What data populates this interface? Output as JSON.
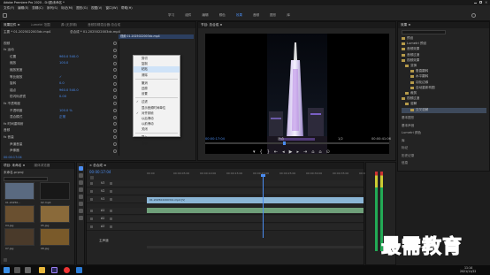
{
  "window": {
    "title": "Adobe Premiere Pro 2020 - D:\\图\\未命名 *"
  },
  "menu": [
    "文件(F)",
    "编辑(E)",
    "剪辑(C)",
    "序列(S)",
    "标记(M)",
    "图形(G)",
    "视图(V)",
    "窗口(W)",
    "帮助(H)"
  ],
  "workspaces": [
    "学习",
    "组件",
    "编辑",
    "颜色",
    "效果",
    "音频",
    "图形",
    "库"
  ],
  "effect_controls": {
    "tabs": [
      "效果控件 ≡",
      "Lumetri 范围",
      "源:(无剪辑)",
      "音频剪辑混合器:总合成"
    ],
    "source_label": "主要 * 01.2025022003dc.mp4",
    "seq_label": "总合成 * 01.2025022003dc.mp4",
    "rows": [
      {
        "name": "视频",
        "value": ""
      },
      {
        "name": "fx 运动",
        "value": ""
      },
      {
        "name": "位置",
        "value": "960.0   540.0"
      },
      {
        "name": "缩放",
        "value": "100.0"
      },
      {
        "name": "缩放宽度",
        "value": ""
      },
      {
        "name": "等比缩放",
        "value": "✓"
      },
      {
        "name": "旋转",
        "value": "0.0"
      },
      {
        "name": "锚点",
        "value": "960.0   540.0"
      },
      {
        "name": "防闪烁滤镜",
        "value": "0.00"
      },
      {
        "name": "fx 不透明度",
        "value": ""
      },
      {
        "name": "不透明度",
        "value": "100.0 %"
      },
      {
        "name": "混合模式",
        "value": "正常"
      },
      {
        "name": "fx 时间重映射",
        "value": ""
      },
      {
        "name": "音频",
        "value": ""
      },
      {
        "name": "fx 音量",
        "value": ""
      },
      {
        "name": "声道音量",
        "value": ""
      },
      {
        "name": "声像器",
        "value": ""
      }
    ],
    "clip_tooltip": "视频 01.2025022003dc.mp4",
    "timecode": "00:00:17:04"
  },
  "context_menu": {
    "items": [
      {
        "label": "剪切",
        "sep": false,
        "check": false,
        "hl": false
      },
      {
        "label": "复制",
        "sep": false,
        "check": false,
        "hl": false
      },
      {
        "label": "粘贴",
        "sep": false,
        "check": false,
        "hl": true
      },
      {
        "label": "清除",
        "sep": false,
        "check": false,
        "hl": false
      },
      {
        "label": "撤消",
        "sep": true,
        "check": false,
        "hl": false
      },
      {
        "label": "还原",
        "sep": false,
        "check": false,
        "hl": false
      },
      {
        "label": "设置",
        "sep": false,
        "check": false,
        "hl": false
      },
      {
        "label": "过滤",
        "sep": true,
        "check": true,
        "hl": false
      },
      {
        "label": "显示音频时间单位",
        "sep": false,
        "check": false,
        "hl": false
      },
      {
        "label": "对齐到帧",
        "sep": false,
        "check": true,
        "hl": false
      },
      {
        "label": "以后滑动",
        "sep": false,
        "check": false,
        "hl": false
      },
      {
        "label": "以前滑动",
        "sep": false,
        "check": false,
        "hl": false
      },
      {
        "label": "关闭",
        "sep": false,
        "check": false,
        "hl": false
      },
      {
        "label": "导入",
        "sep": true,
        "check": false,
        "hl": false
      },
      {
        "label": "帮助",
        "sep": false,
        "check": false,
        "hl": false
      }
    ]
  },
  "program": {
    "tab": "节目: 总合成 ≡",
    "timecode": "00:00:17:04",
    "fit": "适合",
    "quality": "1/2",
    "duration": "00:00:41:06"
  },
  "effects_panel": {
    "tab": "效果 ≡",
    "search_placeholder": "",
    "tree": [
      "预设",
      "Lumetri 预设",
      "音频效果",
      "音频过渡",
      "视频效果",
      "变换",
      "垂直翻转",
      "水平翻转",
      "羽化边缘",
      "自动重新构图",
      "裁剪",
      "视频过渡",
      "溶解",
      "交叉溶解"
    ],
    "sections": [
      "基本图形",
      "基本声音",
      "Lumetri 颜色",
      "库",
      "标记",
      "历史记录",
      "信息"
    ]
  },
  "project": {
    "tabs": [
      "项目: 未命名 ≡",
      "媒体浏览器"
    ],
    "file": "未命名.prproj",
    "items": [
      "01.20250...",
      "02.mp4",
      "04.jpg",
      "05.jpg",
      "07.jpg",
      "08.jpg"
    ]
  },
  "timeline": {
    "tab": "× 总合成 ≡",
    "timecode": "00:00:17:04",
    "ruler": [
      "00:00",
      "00:00:05:00",
      "00:00:10:00",
      "00:00:15:00",
      "00:00:20:00",
      "00:00:25:00",
      "00:00:30:00",
      "00:00:35:00",
      "00:00:40:00"
    ],
    "tracks": [
      "V3",
      "V2",
      "V1",
      "A1",
      "A2",
      "A3"
    ],
    "clip_label": "01.2025022003dc.mp4 [V]",
    "mix_label": "主声道"
  },
  "taskbar": {
    "time": "11:14",
    "date": "2021/11/22"
  },
  "watermark": "最需教育",
  "colors": {
    "accent": "#4a8cf0",
    "clip_video": "#8bb6d6",
    "clip_audio": "#6fa07a",
    "menu_bg": "#f2f2f2"
  }
}
